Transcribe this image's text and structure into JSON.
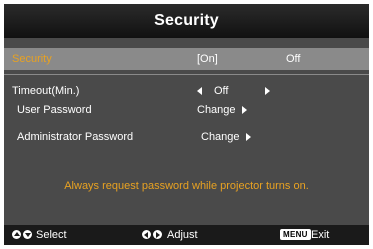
{
  "title": "Security",
  "rows": {
    "security": {
      "label": "Security",
      "on": "[On]",
      "off": "Off"
    },
    "timeout": {
      "label": "Timeout(Min.)",
      "value": "Off"
    },
    "user_password": {
      "label": "User Password",
      "action": "Change"
    },
    "admin_password": {
      "label": "Administrator Password",
      "action": "Change"
    }
  },
  "message": "Always request password while projector turns on.",
  "footer": {
    "select_label": "Select",
    "adjust_label": "Adjust",
    "menu_key": "MENU",
    "exit_label": "Exit"
  },
  "colors": {
    "highlight_text": "#e8a222",
    "panel": "#4a4a4a",
    "highlight_row": "#8a8a8a",
    "footer": "#1a1a1a"
  },
  "icons": [
    "arrow-left-icon",
    "arrow-right-icon",
    "up-down-nav-icon",
    "left-right-nav-icon",
    "menu-key-icon"
  ]
}
